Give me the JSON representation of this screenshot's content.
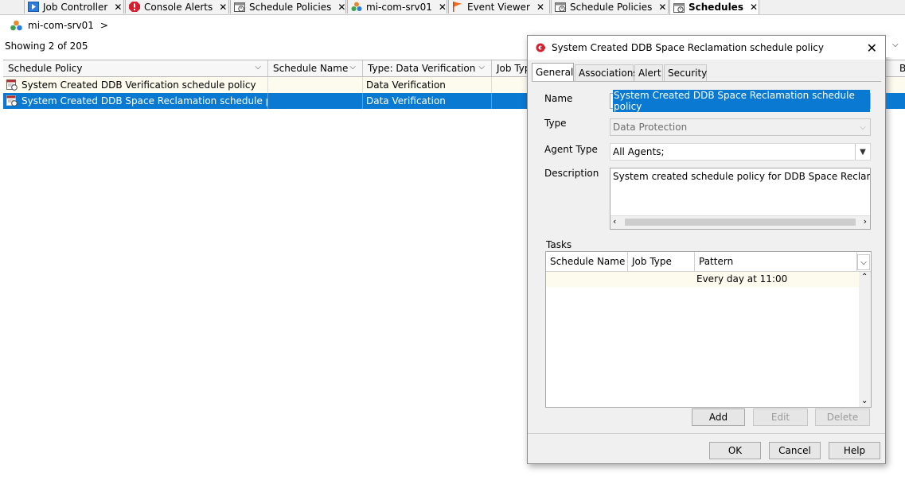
{
  "tabs": [
    {
      "label": "Job Controller",
      "icon": "job-controller-icon"
    },
    {
      "label": "Console Alerts",
      "icon": "alert-icon"
    },
    {
      "label": "Schedule Policies",
      "icon": "schedule-policy-icon"
    },
    {
      "label": "mi-com-srv01",
      "icon": "server-group-icon"
    },
    {
      "label": "Event Viewer",
      "icon": "flag-icon"
    },
    {
      "label": "Schedule Policies",
      "icon": "schedule-policy-icon"
    },
    {
      "label": "Schedules",
      "icon": "schedule-policy-icon"
    }
  ],
  "breadcrumb": {
    "node": "mi-com-srv01",
    "separator": ">"
  },
  "showing": "Showing 2 of 205",
  "grid": {
    "columns": [
      "Schedule Policy",
      "Schedule Name",
      "Type: Data Verification",
      "Job Type",
      "B"
    ],
    "rows": [
      {
        "policy": "System Created DDB Verification schedule policy",
        "schedule_name": "",
        "type": "Data Verification"
      },
      {
        "policy": "System Created DDB Space Reclamation schedule policy",
        "schedule_name": "",
        "type": "Data Verification"
      }
    ]
  },
  "dialog": {
    "title": "System Created DDB Space Reclamation schedule policy",
    "tabs": [
      "General",
      "Associations",
      "Alert",
      "Security"
    ],
    "name_label": "Name",
    "name_value": "System Created DDB Space Reclamation schedule policy",
    "type_label": "Type",
    "type_value": "Data Protection",
    "agent_label": "Agent Type",
    "agent_value": "All Agents;",
    "desc_label": "Description",
    "desc_value": "System created schedule policy for DDB Space Reclamation",
    "tasks_label": "Tasks",
    "tasks_columns": [
      "Schedule Name",
      "Job Type",
      "Pattern"
    ],
    "tasks_rows": [
      {
        "schedule_name": "",
        "job_type": "",
        "pattern": "Every day at 11:00"
      }
    ],
    "buttons": {
      "add": "Add",
      "edit": "Edit",
      "delete": "Delete",
      "ok": "OK",
      "cancel": "Cancel",
      "help": "Help"
    }
  },
  "colors": {
    "selection": "#0a79d2",
    "row_highlight": "#fdfbee",
    "accent_red": "#d6202f"
  }
}
